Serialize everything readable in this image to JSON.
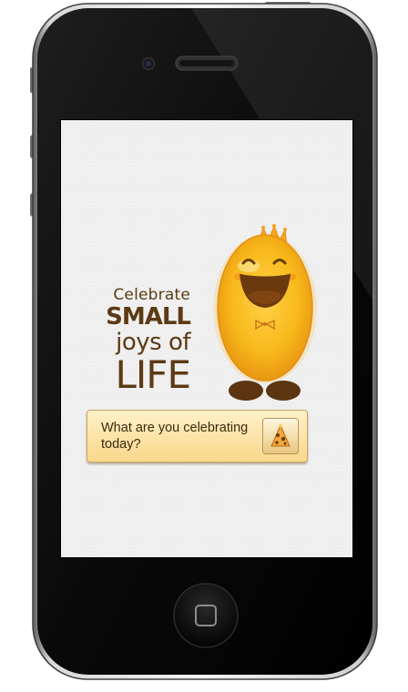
{
  "headline": {
    "line1": "Celebrate",
    "line2": "SMALL",
    "line3": "joys of",
    "line4": "LIFE"
  },
  "cta": {
    "label": "What are you celebrating today?",
    "icon": "party-hat-icon"
  },
  "device": {
    "home_button_icon": "home-square-icon",
    "camera_icon": "front-camera-icon",
    "speaker_icon": "earpiece-speaker-icon"
  },
  "colors": {
    "headline_text": "#5c3a14",
    "mascot_body": "#f6b21a",
    "cta_background": "#f8d88a",
    "phone_bezel": "#0b0b0b"
  }
}
